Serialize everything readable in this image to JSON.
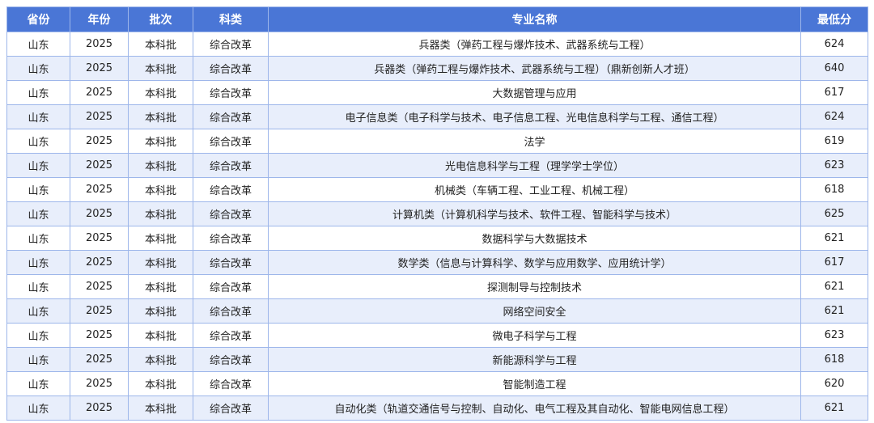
{
  "table": {
    "headers": [
      "省份",
      "年份",
      "批次",
      "科类",
      "专业名称",
      "最低分"
    ],
    "rows": [
      {
        "province": "山东",
        "year": "2025",
        "batch": "本科批",
        "category": "综合改革",
        "major": "兵器类（弹药工程与爆炸技术、武器系统与工程）",
        "min_score": "624"
      },
      {
        "province": "山东",
        "year": "2025",
        "batch": "本科批",
        "category": "综合改革",
        "major": "兵器类（弹药工程与爆炸技术、武器系统与工程）（鼎新创新人才班）",
        "min_score": "640"
      },
      {
        "province": "山东",
        "year": "2025",
        "batch": "本科批",
        "category": "综合改革",
        "major": "大数据管理与应用",
        "min_score": "617"
      },
      {
        "province": "山东",
        "year": "2025",
        "batch": "本科批",
        "category": "综合改革",
        "major": "电子信息类（电子科学与技术、电子信息工程、光电信息科学与工程、通信工程）",
        "min_score": "624"
      },
      {
        "province": "山东",
        "year": "2025",
        "batch": "本科批",
        "category": "综合改革",
        "major": "法学",
        "min_score": "619"
      },
      {
        "province": "山东",
        "year": "2025",
        "batch": "本科批",
        "category": "综合改革",
        "major": "光电信息科学与工程（理学学士学位）",
        "min_score": "623"
      },
      {
        "province": "山东",
        "year": "2025",
        "batch": "本科批",
        "category": "综合改革",
        "major": "机械类（车辆工程、工业工程、机械工程）",
        "min_score": "618"
      },
      {
        "province": "山东",
        "year": "2025",
        "batch": "本科批",
        "category": "综合改革",
        "major": "计算机类（计算机科学与技术、软件工程、智能科学与技术）",
        "min_score": "625"
      },
      {
        "province": "山东",
        "year": "2025",
        "batch": "本科批",
        "category": "综合改革",
        "major": "数据科学与大数据技术",
        "min_score": "621"
      },
      {
        "province": "山东",
        "year": "2025",
        "batch": "本科批",
        "category": "综合改革",
        "major": "数学类（信息与计算科学、数学与应用数学、应用统计学）",
        "min_score": "617"
      },
      {
        "province": "山东",
        "year": "2025",
        "batch": "本科批",
        "category": "综合改革",
        "major": "探测制导与控制技术",
        "min_score": "621"
      },
      {
        "province": "山东",
        "year": "2025",
        "batch": "本科批",
        "category": "综合改革",
        "major": "网络空间安全",
        "min_score": "621"
      },
      {
        "province": "山东",
        "year": "2025",
        "batch": "本科批",
        "category": "综合改革",
        "major": "微电子科学与工程",
        "min_score": "623"
      },
      {
        "province": "山东",
        "year": "2025",
        "batch": "本科批",
        "category": "综合改革",
        "major": "新能源科学与工程",
        "min_score": "618"
      },
      {
        "province": "山东",
        "year": "2025",
        "batch": "本科批",
        "category": "综合改革",
        "major": "智能制造工程",
        "min_score": "620"
      },
      {
        "province": "山东",
        "year": "2025",
        "batch": "本科批",
        "category": "综合改革",
        "major": "自动化类（轨道交通信号与控制、自动化、电气工程及其自动化、智能电网信息工程）",
        "min_score": "621"
      }
    ]
  },
  "colors": {
    "header_bg": "#4a76d6",
    "header_text": "#ffffff",
    "row_alt_bg": "#e8eefb",
    "border": "#9db6ea"
  }
}
